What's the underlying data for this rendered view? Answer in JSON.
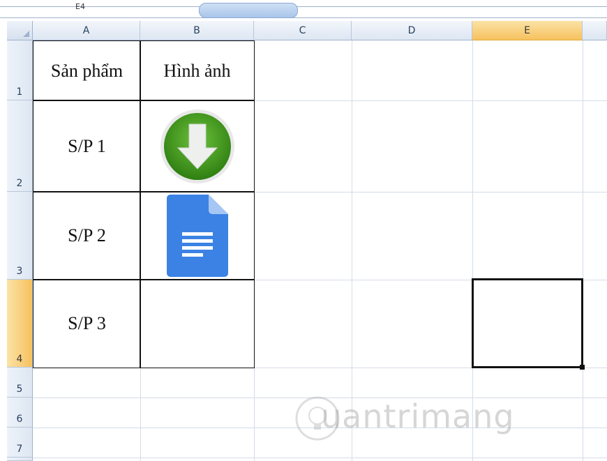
{
  "topbar": {
    "clip_text": "E4",
    "tab_text": ""
  },
  "columns": [
    "A",
    "B",
    "C",
    "D",
    "E"
  ],
  "rows": [
    "1",
    "2",
    "3",
    "4",
    "5",
    "6",
    "7"
  ],
  "cells": {
    "A1": "Sản phẩm",
    "B1": "Hình ảnh",
    "A2": "S/P 1",
    "A3": "S/P 2",
    "A4": "S/P 3"
  },
  "images": {
    "B2": "download-arrow-icon",
    "B3": "document-icon"
  },
  "selected_cell": "E4",
  "colors": {
    "selection_header": "#f6c15e",
    "header": "#dde6f2",
    "download_green": "#3f9a1c",
    "doc_blue": "#3b82e4"
  },
  "watermark": {
    "text": "uantrimang"
  }
}
